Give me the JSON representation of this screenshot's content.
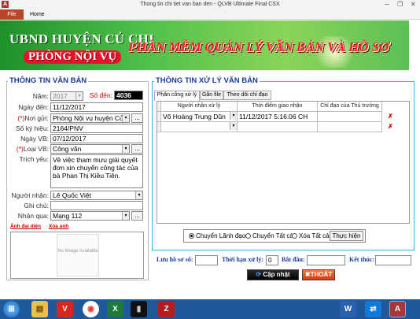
{
  "window": {
    "title": "Thong tin chi tiet van ban den - QLVB Ultimate Final CSX"
  },
  "ribbon": {
    "file": "File",
    "home": "Home"
  },
  "banner": {
    "org": "UBND HUYỆN CỦ CHI",
    "dept": "PHÒNG NỘI VỤ",
    "app_name": "PHẦN MỀM QUẢN LÝ VĂN BẢN VÀ HỒ SƠ"
  },
  "left": {
    "section_title": "THÔNG TIN VĂN BẢN",
    "year_label": "Năm:",
    "year_value": "2017",
    "so_den_label": "Số đến:",
    "so_den_value": "4036",
    "ngay_den_label": "Ngày đến:",
    "ngay_den_value": "11/12/2017",
    "noi_gui_label": "Nơi gửi:",
    "noi_gui_value": "Phòng Nội vụ huyện Củ",
    "so_ky_hieu_label": "Số ký hiệu:",
    "so_ky_hieu_value": "2164/PNV",
    "ngay_vb_label": "Ngày VB:",
    "ngay_vb_value": "07/12/2017",
    "loai_vb_label": "Loại VB:",
    "loai_vb_value": "Công văn",
    "trich_yeu_label": "Trích yếu:",
    "trich_yeu_value": "Về việc tham mưu giải quyết đơn xin chuyển công tác của bà Phan Thị Kiều Tiên.",
    "nguoi_nhan_label": "Người nhận:",
    "nguoi_nhan_value": "Lê Quốc Việt",
    "ghi_chu_label": "Ghi chú:",
    "ghi_chu_value": "",
    "nhan_qua_label": "Nhận qua:",
    "nhan_qua_value": "Mạng 112",
    "anh_dai_dien": "Ảnh đại diện",
    "xoa_anh": "Xóa ảnh",
    "no_image": "No Image Available",
    "browse": "...",
    "req_mark": "(*)"
  },
  "right": {
    "section_title": "THÔNG TIN XỬ LÝ VĂN BẢN",
    "tabs": [
      "Phân công xử lý",
      "Gắn file",
      "Theo dõi chỉ đạo"
    ],
    "columns": [
      "Người nhận xử lý",
      "Thời điểm giao nhận",
      "Chỉ đạo của Thủ trưởng"
    ],
    "rows": [
      {
        "nguoi_nhan": "Võ Hoàng Trung Dũn",
        "thoi_diem": "11/12/2017 5:16:06 CH",
        "chi_dao": ""
      }
    ],
    "radios": [
      {
        "label": "Chuyển Lãnh đạo",
        "checked": true
      },
      {
        "label": "Chuyển Tất cả",
        "checked": false
      },
      {
        "label": "Xóa Tất cả",
        "checked": false
      }
    ],
    "thuc_hien": "Thực hiện"
  },
  "bottom": {
    "luu_ho_so_label": "Lưu hồ sơ số:",
    "thoi_han_label": "Thời hạn xử lý:",
    "thoi_han_value": "0",
    "bat_dau_label": "Bắt đầu:",
    "ket_thuc_label": "Kết thúc:",
    "cap_nhat": "Cập nhật",
    "thoat": "THOÁT"
  },
  "taskbar": {
    "icons": [
      "start-icon",
      "explorer-icon",
      "unikey-icon",
      "chrome-icon",
      "excel-icon",
      "cmd-icon",
      "filezilla-icon",
      "word-icon",
      "teamviewer-icon",
      "access-icon"
    ]
  },
  "colors": {
    "section_title": "#1a3a9a",
    "frame_border": "#35b8e4",
    "banner_green": "#3fae3a",
    "red": "#e8132b"
  }
}
